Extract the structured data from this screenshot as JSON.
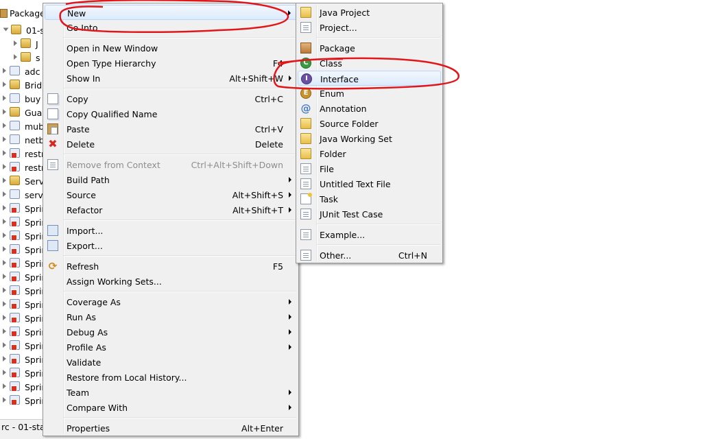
{
  "explorer": {
    "header": "Package",
    "rows": [
      {
        "text": "01-s",
        "icon": "project-icon",
        "expanded": true
      },
      {
        "text": "J",
        "icon": "library-icon"
      },
      {
        "text": "s",
        "icon": "source-folder-icon"
      },
      {
        "text": "adc",
        "icon": "maven-project-icon"
      },
      {
        "text": "Brid",
        "icon": "project-icon"
      },
      {
        "text": "buy",
        "icon": "maven-project-icon"
      },
      {
        "text": "Guar",
        "icon": "project-icon"
      },
      {
        "text": "mub",
        "icon": "maven-project-icon"
      },
      {
        "text": "netb",
        "icon": "maven-project-icon"
      },
      {
        "text": "restr",
        "icon": "maven-error-project-icon"
      },
      {
        "text": "restr",
        "icon": "maven-error-project-icon"
      },
      {
        "text": "Serv",
        "icon": "project-icon"
      },
      {
        "text": "serv",
        "icon": "maven-project-icon"
      },
      {
        "text": "Sprir",
        "icon": "maven-error-project-icon"
      },
      {
        "text": "Sprir",
        "icon": "maven-error-project-icon"
      },
      {
        "text": "Sprir",
        "icon": "maven-error-project-icon"
      },
      {
        "text": "Sprir",
        "icon": "maven-error-project-icon"
      },
      {
        "text": "Sprir",
        "icon": "maven-error-project-icon"
      },
      {
        "text": "Sprir",
        "icon": "maven-error-project-icon"
      },
      {
        "text": "Sprir",
        "icon": "maven-error-project-icon"
      },
      {
        "text": "Sprir",
        "icon": "maven-error-project-icon"
      },
      {
        "text": "Sprir",
        "icon": "maven-error-project-icon"
      },
      {
        "text": "Sprir",
        "icon": "maven-error-project-icon"
      },
      {
        "text": "Sprir",
        "icon": "maven-error-project-icon"
      },
      {
        "text": "Sprir",
        "icon": "maven-error-project-icon"
      },
      {
        "text": "Sprir",
        "icon": "maven-error-project-icon"
      },
      {
        "text": "Sprir",
        "icon": "maven-error-project-icon"
      },
      {
        "text": "Sprir",
        "icon": "maven-error-project-icon"
      }
    ],
    "status": "rc - 01-stat"
  },
  "context_menu": {
    "groups": [
      [
        {
          "label": "New",
          "shortcut": "",
          "submenu": true,
          "icon": "",
          "highlighted": true
        },
        {
          "label": "Go Into",
          "shortcut": "",
          "submenu": false,
          "icon": ""
        }
      ],
      [
        {
          "label": "Open in New Window",
          "shortcut": "",
          "submenu": false,
          "icon": ""
        },
        {
          "label": "Open Type Hierarchy",
          "shortcut": "F4",
          "submenu": false,
          "icon": ""
        },
        {
          "label": "Show In",
          "shortcut": "Alt+Shift+W",
          "submenu": true,
          "icon": ""
        }
      ],
      [
        {
          "label": "Copy",
          "shortcut": "Ctrl+C",
          "submenu": false,
          "icon": "copy-icon"
        },
        {
          "label": "Copy Qualified Name",
          "shortcut": "",
          "submenu": false,
          "icon": "copy-qualified-icon"
        },
        {
          "label": "Paste",
          "shortcut": "Ctrl+V",
          "submenu": false,
          "icon": "paste-icon"
        },
        {
          "label": "Delete",
          "shortcut": "Delete",
          "submenu": false,
          "icon": "delete-icon"
        }
      ],
      [
        {
          "label": "Remove from Context",
          "shortcut": "Ctrl+Alt+Shift+Down",
          "submenu": false,
          "icon": "remove-context-icon",
          "disabled": true
        },
        {
          "label": "Build Path",
          "shortcut": "",
          "submenu": true,
          "icon": ""
        },
        {
          "label": "Source",
          "shortcut": "Alt+Shift+S",
          "submenu": true,
          "icon": ""
        },
        {
          "label": "Refactor",
          "shortcut": "Alt+Shift+T",
          "submenu": true,
          "icon": ""
        }
      ],
      [
        {
          "label": "Import...",
          "shortcut": "",
          "submenu": false,
          "icon": "import-icon"
        },
        {
          "label": "Export...",
          "shortcut": "",
          "submenu": false,
          "icon": "export-icon"
        }
      ],
      [
        {
          "label": "Refresh",
          "shortcut": "F5",
          "submenu": false,
          "icon": "refresh-icon"
        },
        {
          "label": "Assign Working Sets...",
          "shortcut": "",
          "submenu": false,
          "icon": ""
        }
      ],
      [
        {
          "label": "Coverage As",
          "shortcut": "",
          "submenu": true,
          "icon": ""
        },
        {
          "label": "Run As",
          "shortcut": "",
          "submenu": true,
          "icon": ""
        },
        {
          "label": "Debug As",
          "shortcut": "",
          "submenu": true,
          "icon": ""
        },
        {
          "label": "Profile As",
          "shortcut": "",
          "submenu": true,
          "icon": ""
        },
        {
          "label": "Validate",
          "shortcut": "",
          "submenu": false,
          "icon": ""
        },
        {
          "label": "Restore from Local History...",
          "shortcut": "",
          "submenu": false,
          "icon": ""
        },
        {
          "label": "Team",
          "shortcut": "",
          "submenu": true,
          "icon": ""
        },
        {
          "label": "Compare With",
          "shortcut": "",
          "submenu": true,
          "icon": ""
        }
      ],
      [
        {
          "label": "Properties",
          "shortcut": "Alt+Enter",
          "submenu": false,
          "icon": ""
        }
      ]
    ]
  },
  "new_submenu": {
    "groups": [
      [
        {
          "label": "Java Project",
          "shortcut": "",
          "icon": "java-project-icon"
        },
        {
          "label": "Project...",
          "shortcut": "",
          "icon": "project-wizard-icon"
        }
      ],
      [
        {
          "label": "Package",
          "shortcut": "",
          "icon": "package-icon"
        },
        {
          "label": "Class",
          "shortcut": "",
          "icon": "class-icon"
        },
        {
          "label": "Interface",
          "shortcut": "",
          "icon": "interface-icon",
          "highlighted": true
        },
        {
          "label": "Enum",
          "shortcut": "",
          "icon": "enum-icon"
        },
        {
          "label": "Annotation",
          "shortcut": "",
          "icon": "annotation-icon"
        },
        {
          "label": "Source Folder",
          "shortcut": "",
          "icon": "source-folder-icon"
        },
        {
          "label": "Java Working Set",
          "shortcut": "",
          "icon": "working-set-icon"
        },
        {
          "label": "Folder",
          "shortcut": "",
          "icon": "folder-icon"
        },
        {
          "label": "File",
          "shortcut": "",
          "icon": "file-icon"
        },
        {
          "label": "Untitled Text File",
          "shortcut": "",
          "icon": "text-file-icon"
        },
        {
          "label": "Task",
          "shortcut": "",
          "icon": "task-icon"
        },
        {
          "label": "JUnit Test Case",
          "shortcut": "",
          "icon": "junit-icon"
        }
      ],
      [
        {
          "label": "Example...",
          "shortcut": "",
          "icon": "example-icon"
        }
      ],
      [
        {
          "label": "Other...",
          "shortcut": "Ctrl+N",
          "icon": "other-wizard-icon"
        }
      ]
    ]
  },
  "annotation_color": "#e0161b"
}
